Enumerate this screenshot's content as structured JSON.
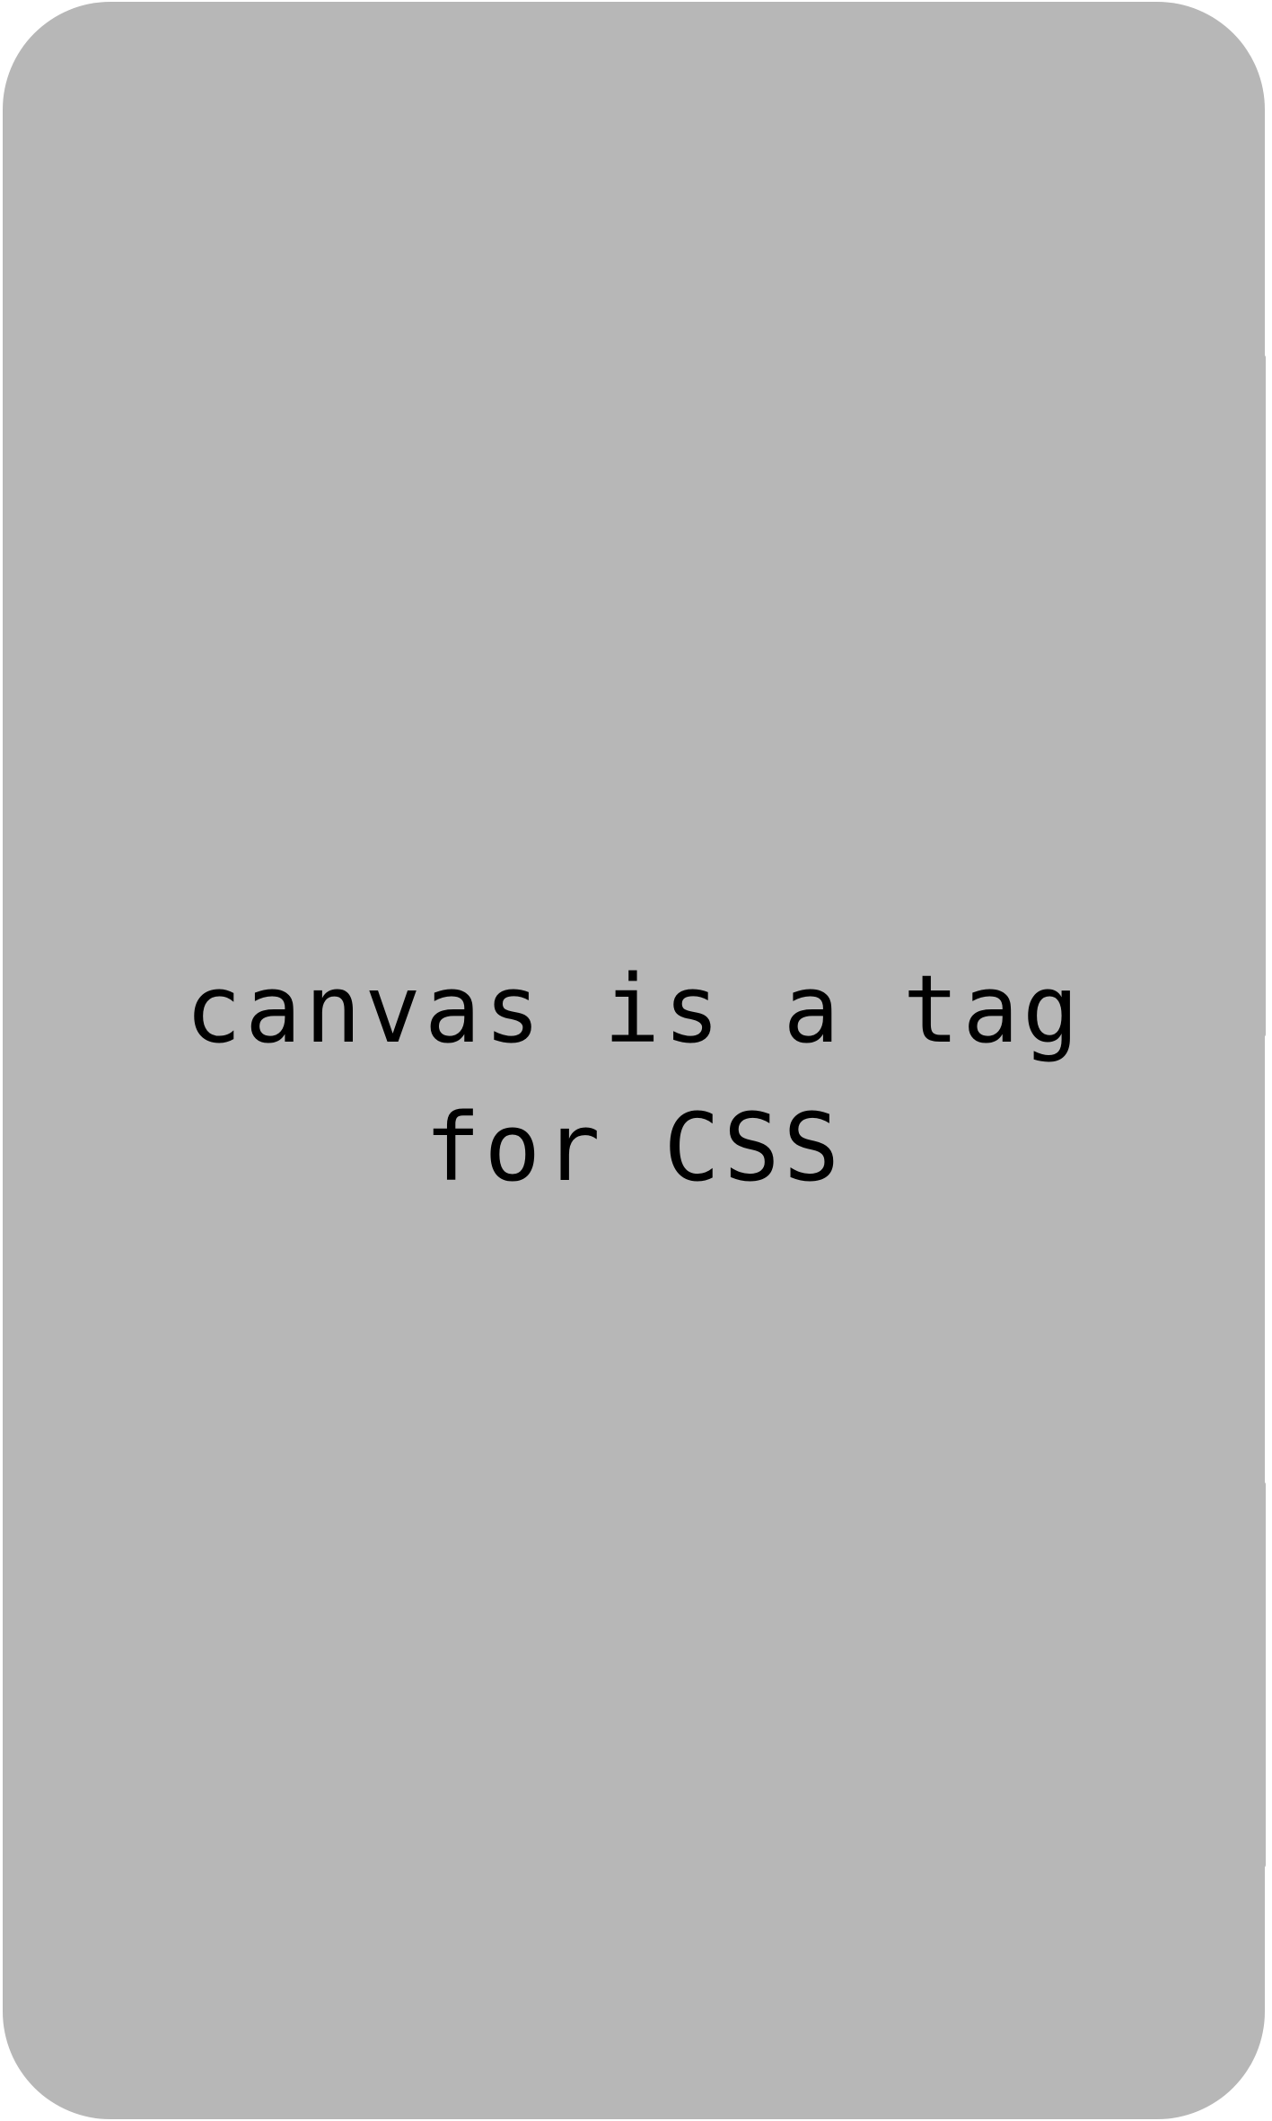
{
  "canvas": {
    "background_color": "#b7b7b7",
    "text_color": "#000000",
    "message_line_1": "canvas is a tag",
    "message_line_2": "for CSS"
  }
}
